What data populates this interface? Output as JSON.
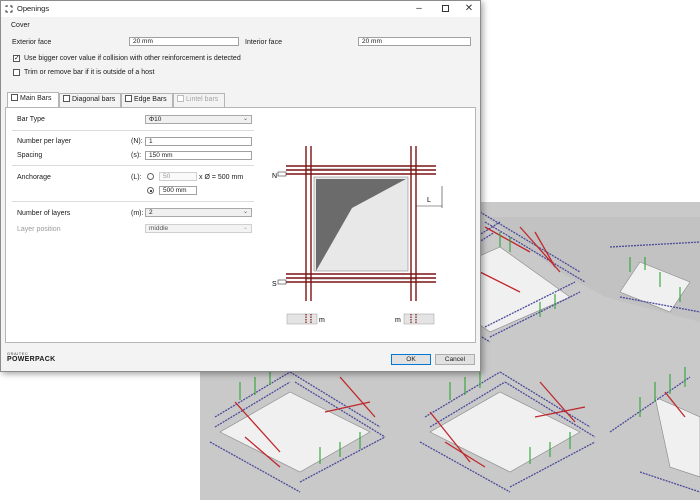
{
  "window": {
    "title": "Openings",
    "app_icon": "graitec-icon"
  },
  "cover": {
    "section_label": "Cover",
    "exterior_face_label": "Exterior face",
    "exterior_face_value": "20 mm",
    "interior_face_label": "Interior face",
    "interior_face_value": "20 mm",
    "use_bigger_cover_label": "Use bigger cover value if collision with other reinforcement is detected",
    "use_bigger_cover_checked": true,
    "trim_label": "Trim or remove bar if it is outside of a host",
    "trim_checked": false
  },
  "tabs": [
    {
      "label": "Main Bars",
      "active": true,
      "enabled": true
    },
    {
      "label": "Diagonal bars",
      "active": false,
      "enabled": true
    },
    {
      "label": "Edge Bars",
      "active": false,
      "enabled": true
    },
    {
      "label": "Lintel bars",
      "active": false,
      "enabled": false
    }
  ],
  "main_bars": {
    "bar_type_label": "Bar Type",
    "bar_type_value": "Φ10",
    "number_per_layer_label": "Number per layer",
    "number_per_layer_code": "(N):",
    "number_per_layer_value": "1",
    "spacing_label": "Spacing",
    "spacing_code": "(s):",
    "spacing_value": "150 mm",
    "anchorage_label": "Anchorage",
    "anchorage_code": "(L):",
    "anchorage_factor_value": "50",
    "anchorage_factor_suffix": "x Ø = 500 mm",
    "anchorage_length_value": "500 mm",
    "anchorage_selected": "length",
    "number_of_layers_label": "Number of layers",
    "number_of_layers_code": "(m):",
    "number_of_layers_value": "2",
    "layer_position_label": "Layer position",
    "layer_position_value": "middle"
  },
  "diagram": {
    "label_n": "N",
    "label_s": "S",
    "label_l": "L",
    "label_m1": "m",
    "label_m2": "m",
    "bar_color": "#7b1414",
    "opening_color": "#6b6b6b"
  },
  "footer": {
    "brand_top": "GRAITEC",
    "brand_bottom": "POWERPACK",
    "ok_label": "OK",
    "cancel_label": "Cancel"
  },
  "colors": {
    "background_3d": "#c9c9c9",
    "rebar_red": "#c0282d",
    "rebar_blue": "#4b4b9b",
    "rebar_green": "#2fa335"
  }
}
